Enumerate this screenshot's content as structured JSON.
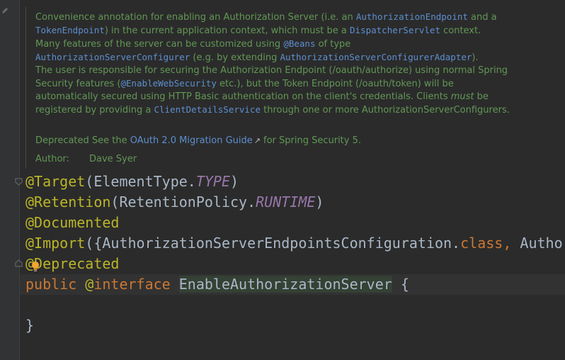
{
  "doc": {
    "para": [
      {
        "t": "Convenience annotation for enabling an Authorization Server (i.e. an "
      },
      {
        "t": "AuthorizationEndpoint",
        "c": "code"
      },
      {
        "t": " and a"
      },
      {
        "br": true
      },
      {
        "t": "TokenEndpoint",
        "c": "code"
      },
      {
        "t": ") in the current application context, which must be a "
      },
      {
        "t": "DispatcherServlet",
        "c": "code"
      },
      {
        "t": " context."
      },
      {
        "br": true
      },
      {
        "t": "Many features of the server can be customized using "
      },
      {
        "t": "@Beans",
        "c": "code"
      },
      {
        "t": " of type"
      },
      {
        "br": true
      },
      {
        "t": "AuthorizationServerConfigurer",
        "c": "code"
      },
      {
        "t": " (e.g. by extending "
      },
      {
        "t": "AuthorizationServerConfigurerAdapter",
        "c": "code"
      },
      {
        "t": ")."
      },
      {
        "br": true
      },
      {
        "t": "The user is responsible for securing the Authorization Endpoint (/oauth/authorize) using normal Spring"
      },
      {
        "br": true
      },
      {
        "t": "Security features ("
      },
      {
        "t": "@EnableWebSecurity",
        "c": "code"
      },
      {
        "t": " etc.), but the Token Endpoint (/oauth/token) will be"
      },
      {
        "br": true
      },
      {
        "t": "automatically secured using HTTP Basic authentication on the client's credentials. Clients "
      },
      {
        "t": "must",
        "c": "em"
      },
      {
        "t": " be"
      },
      {
        "br": true
      },
      {
        "t": "registered by providing a "
      },
      {
        "t": "ClientDetailsService",
        "c": "code"
      },
      {
        "t": " through one or more AuthorizationServerConfigurers."
      }
    ],
    "deprecated_label": "Deprecated",
    "deprecated_prefix": " See the ",
    "deprecated_link": "OAuth 2.0 Migration Guide",
    "deprecated_suffix": "for Spring Security 5.",
    "author_label": "Author:",
    "author_name": "Dave Syer"
  },
  "code": {
    "line1": {
      "at": "@",
      "name": "Target",
      "open": "(ElementType.",
      "const": "TYPE",
      "close": ")"
    },
    "line2": {
      "at": "@",
      "name": "Retention",
      "open": "(RetentionPolicy.",
      "const": "RUNTIME",
      "close": ")"
    },
    "line3": {
      "at": "@",
      "name": "Documented"
    },
    "line4": {
      "at": "@",
      "name": "Import",
      "open": "({AuthorizationServerEndpointsConfiguration.",
      "kw": "class,",
      "rest": " Authoriz"
    },
    "line5": {
      "at": "@",
      "name": "Deprecated"
    },
    "line6": {
      "kw_public": "public",
      "sp1": " ",
      "at": "@",
      "kw_interface": "interface",
      "sp2": " ",
      "class_name": "EnableAuthorizationServer",
      "brace": " {"
    },
    "line8": {
      "brace": "}"
    }
  },
  "icons": {
    "gutter_edit": "pencil-icon",
    "fold": "fold-marker-icon",
    "intention": "lightbulb-icon",
    "external_link": "external-link-icon"
  },
  "colors": {
    "background": "#2b2b2b",
    "doc_text": "#629755",
    "doc_code": "#5d8fcf",
    "annotation": "#bbb529",
    "keyword": "#cc7832",
    "constant": "#9876aa",
    "plain": "#a9b7c6"
  }
}
